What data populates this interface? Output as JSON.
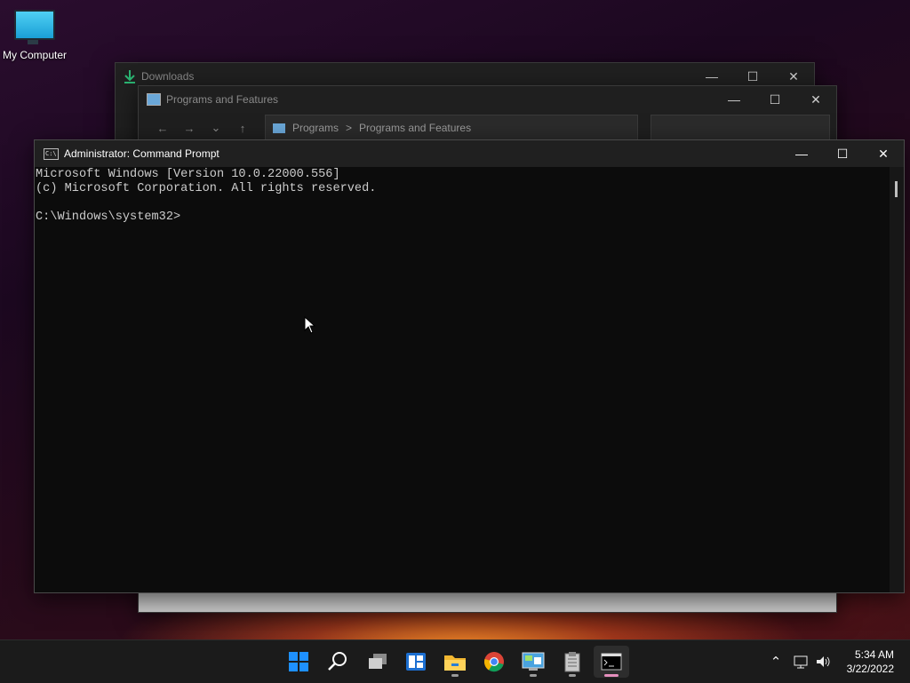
{
  "desktop": {
    "icon_label": "My Computer"
  },
  "windows": {
    "downloads": {
      "title": "Downloads"
    },
    "programs": {
      "title": "Programs and Features",
      "breadcrumb": [
        "Programs",
        "Programs and Features"
      ],
      "breadcrumb_sep": ">"
    },
    "cmd": {
      "title": "Administrator: Command Prompt",
      "lines": [
        "Microsoft Windows [Version 10.0.22000.556]",
        "(c) Microsoft Corporation. All rights reserved.",
        "",
        "C:\\Windows\\system32>"
      ]
    }
  },
  "taskbar": {
    "apps": [
      "start",
      "search",
      "task-view",
      "widgets",
      "file-explorer",
      "chrome",
      "control-panel",
      "notepad-archive",
      "command-prompt"
    ],
    "clock_time": "5:34 AM",
    "clock_date": "3/22/2022"
  },
  "colors": {
    "accent_green": "#2bb673",
    "start_blue": "#1e90ff",
    "cmd_bg": "#0c0c0c"
  }
}
